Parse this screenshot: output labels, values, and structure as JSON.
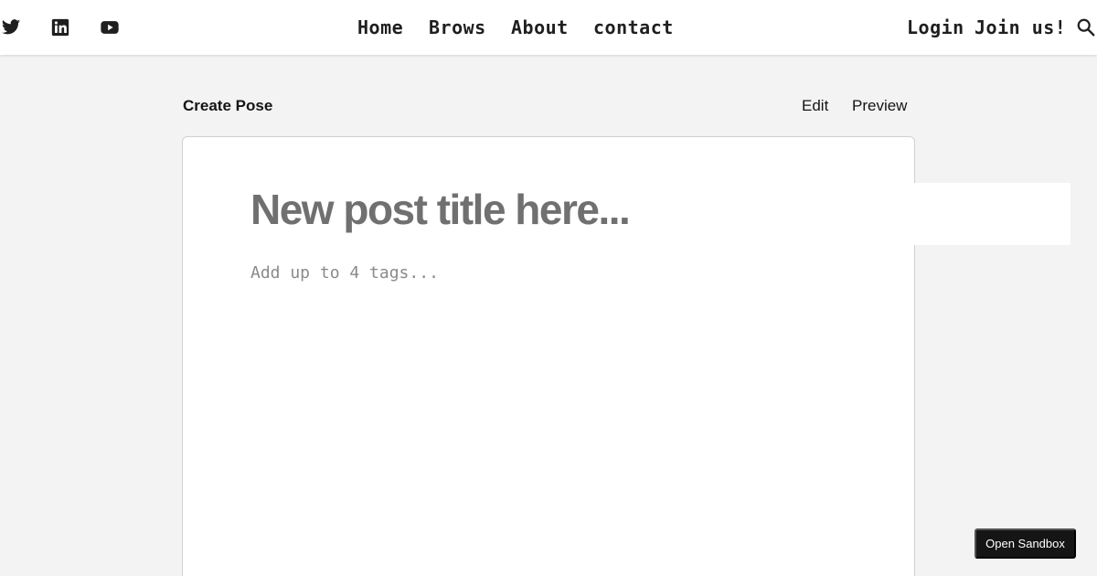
{
  "header": {
    "social": [
      {
        "icon": "twitter-icon"
      },
      {
        "icon": "linkedin-icon"
      },
      {
        "icon": "youtube-icon"
      }
    ],
    "nav": [
      "Home",
      "Brows",
      "About",
      "contact"
    ],
    "login_label": "Login",
    "join_label": "Join us!",
    "search_icon": "search-icon"
  },
  "page": {
    "title": "Create Pose",
    "edit_label": "Edit",
    "preview_label": "Preview"
  },
  "editor": {
    "title_placeholder": "New post title here...",
    "tags_placeholder": "Add up to 4 tags..."
  },
  "sandbox": {
    "label": "Open Sandbox"
  },
  "colors": {
    "header_bg": "#ffffff",
    "page_bg": "#f3f3f3",
    "title_placeholder": "#707070",
    "sandbox_bg": "#151515"
  }
}
